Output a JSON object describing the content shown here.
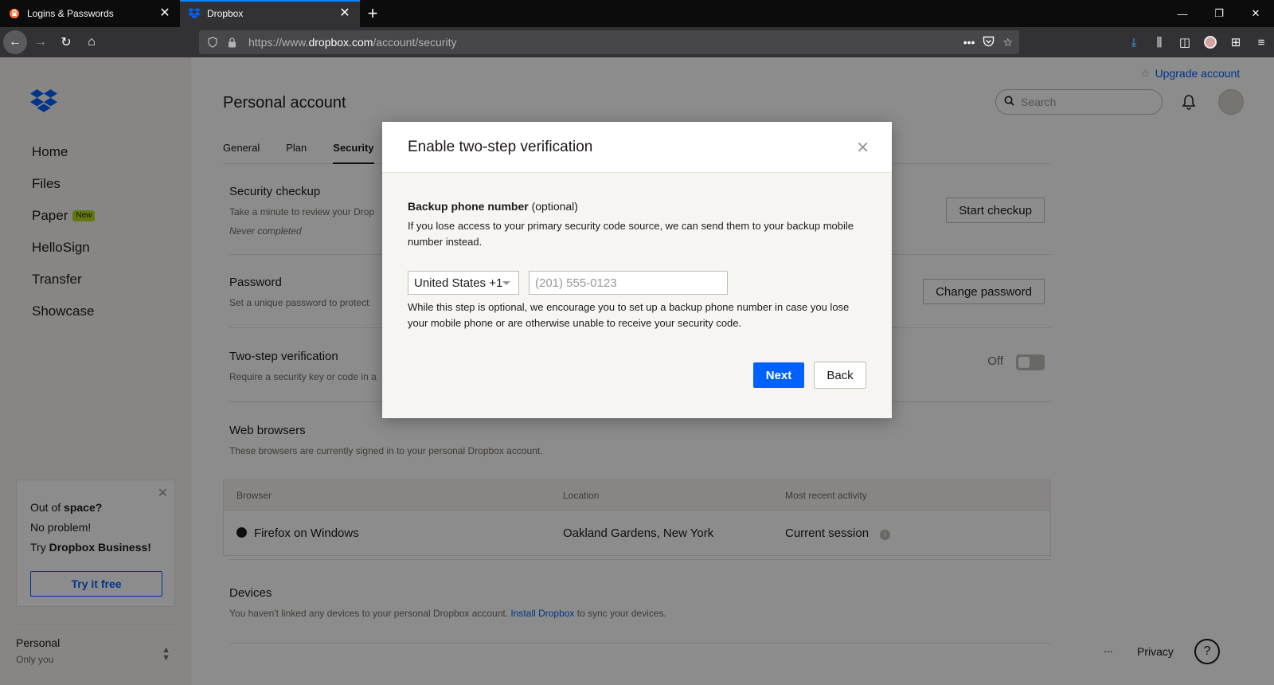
{
  "browser": {
    "tabs": [
      {
        "title": "Logins & Passwords",
        "active": false
      },
      {
        "title": "Dropbox",
        "active": true
      }
    ],
    "url_prefix": "https://www.",
    "url_domain": "dropbox.com",
    "url_path": "/account/security"
  },
  "sidebar": {
    "nav": [
      "Home",
      "Files",
      "Paper",
      "HelloSign",
      "Transfer",
      "Showcase"
    ],
    "paper_badge": "New",
    "promo": {
      "line1_pre": "Out of ",
      "line1_bold": "space?",
      "line2": "No problem!",
      "line3_pre": "Try ",
      "line3_bold": "Dropbox Business!",
      "button": "Try it free"
    },
    "account": {
      "name": "Personal",
      "sub": "Only you"
    }
  },
  "header": {
    "upgrade": "Upgrade account",
    "search_placeholder": "Search"
  },
  "main": {
    "title": "Personal account",
    "tabs": [
      "General",
      "Plan",
      "Security"
    ],
    "active_tab": "Security",
    "sections": {
      "checkup": {
        "title": "Security checkup",
        "desc": "Take a minute to review your Drop",
        "status": "Never completed",
        "button": "Start checkup"
      },
      "password": {
        "title": "Password",
        "desc": "Set a unique password to protect",
        "button": "Change password"
      },
      "twostep": {
        "title": "Two-step verification",
        "desc": "Require a security key or code in a",
        "state": "Off"
      },
      "browsers": {
        "title": "Web browsers",
        "desc": "These browsers are currently signed in to your personal Dropbox account."
      },
      "devices": {
        "title": "Devices",
        "desc_pre": "You haven't linked any devices to your personal Dropbox account. ",
        "link": "Install Dropbox",
        "desc_post": " to sync your devices."
      }
    },
    "browser_table": {
      "headers": [
        "Browser",
        "Location",
        "Most recent activity"
      ],
      "rows": [
        {
          "browser": "Firefox on Windows",
          "location": "Oakland Gardens, New York",
          "activity": "Current session"
        }
      ]
    },
    "footer": {
      "more": "...",
      "privacy": "Privacy",
      "help": "?"
    }
  },
  "modal": {
    "title": "Enable two-step verification",
    "label": "Backup phone number",
    "label_opt": "(optional)",
    "desc": "If you lose access to your primary security code source, we can send them to your backup mobile number instead.",
    "country": "United States +1",
    "phone_placeholder": "(201) 555-0123",
    "note": "While this step is optional, we encourage you to set up a backup phone number in case you lose your mobile phone or are otherwise unable to receive your security code.",
    "next": "Next",
    "back": "Back"
  },
  "colors": {
    "accent": "#0061fe",
    "chrome": "#323234"
  }
}
